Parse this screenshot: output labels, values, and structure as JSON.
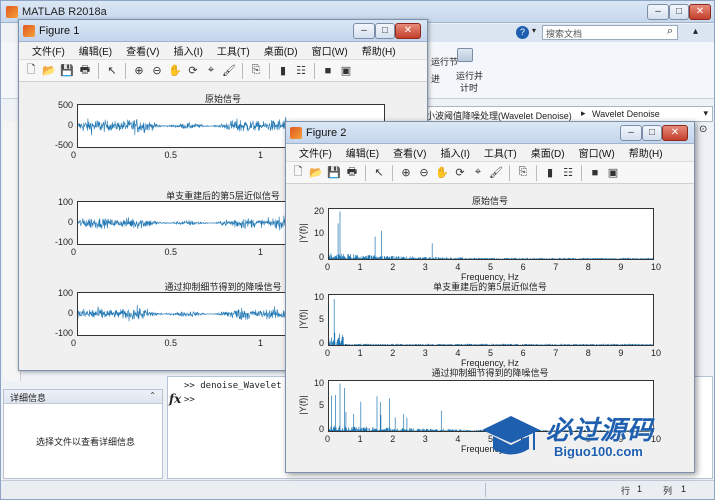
{
  "matlab": {
    "title": "MATLAB R2018a",
    "search_placeholder": "搜索文档",
    "ribbon_btn1_line1": "运行节",
    "ribbon_btn2_line1": "运行并",
    "ribbon_btn2_line2": "计时",
    "ribbon_partial": "进",
    "address_path_1": "小波阈值降噪处理(Wavelet Denoise)",
    "address_sep": "▸",
    "address_path_2": "Wavelet Denoise",
    "details_header": "详细信息",
    "details_text": "选择文件以查看详细信息",
    "command_line1": ">> denoise_Wavelet",
    "command_line2": ">>",
    "fx_symbol": "fx",
    "status_row_label": "行",
    "status_row_value": "1",
    "status_col_label": "列",
    "status_col_value": "1"
  },
  "figure1": {
    "title": "Figure 1",
    "menus": [
      "文件(F)",
      "编辑(E)",
      "查看(V)",
      "插入(I)",
      "工具(T)",
      "桌面(D)",
      "窗口(W)",
      "帮助(H)"
    ],
    "plots": [
      {
        "title": "原始信号",
        "yticks": [
          "500",
          "0",
          "-500"
        ],
        "xticks": [
          "0",
          "0.5",
          "1",
          "1.5"
        ]
      },
      {
        "title": "单支重建后的第5层近似信号",
        "yticks": [
          "100",
          "0",
          "-100"
        ],
        "xticks": [
          "0",
          "0.5",
          "1",
          "1.5"
        ]
      },
      {
        "title": "通过抑制细节得到的降噪信号",
        "yticks": [
          "100",
          "0",
          "-100"
        ],
        "xticks": [
          "0",
          "0.5",
          "1",
          "1.5"
        ]
      }
    ]
  },
  "figure2": {
    "title": "Figure 2",
    "menus": [
      "文件(F)",
      "编辑(E)",
      "查看(V)",
      "插入(I)",
      "工具(T)",
      "桌面(D)",
      "窗口(W)",
      "帮助(H)"
    ],
    "plots": [
      {
        "title": "原始信号",
        "ylabel": "|Y(f)|",
        "yticks": [
          "20",
          "10",
          "0"
        ],
        "xlabel": "Frequency, Hz"
      },
      {
        "title": "单支重建后的第5层近似信号",
        "ylabel": "|Y(f)|",
        "yticks": [
          "10",
          "5",
          "0"
        ],
        "xlabel": "Frequency, Hz"
      },
      {
        "title": "通过抑制细节得到的降噪信号",
        "ylabel": "|Y(f)|",
        "yticks": [
          "10",
          "5",
          "0"
        ],
        "xlabel": "Frequency, Hz"
      }
    ],
    "xticks": [
      "0",
      "1",
      "2",
      "3",
      "4",
      "5",
      "6",
      "7",
      "8",
      "9",
      "10"
    ]
  },
  "watermark": {
    "brand_cn": "必过源码",
    "brand_url": "Biguo100.com"
  },
  "colors": {
    "signal": "#1f77b4",
    "accent": "#1e5fb0"
  }
}
